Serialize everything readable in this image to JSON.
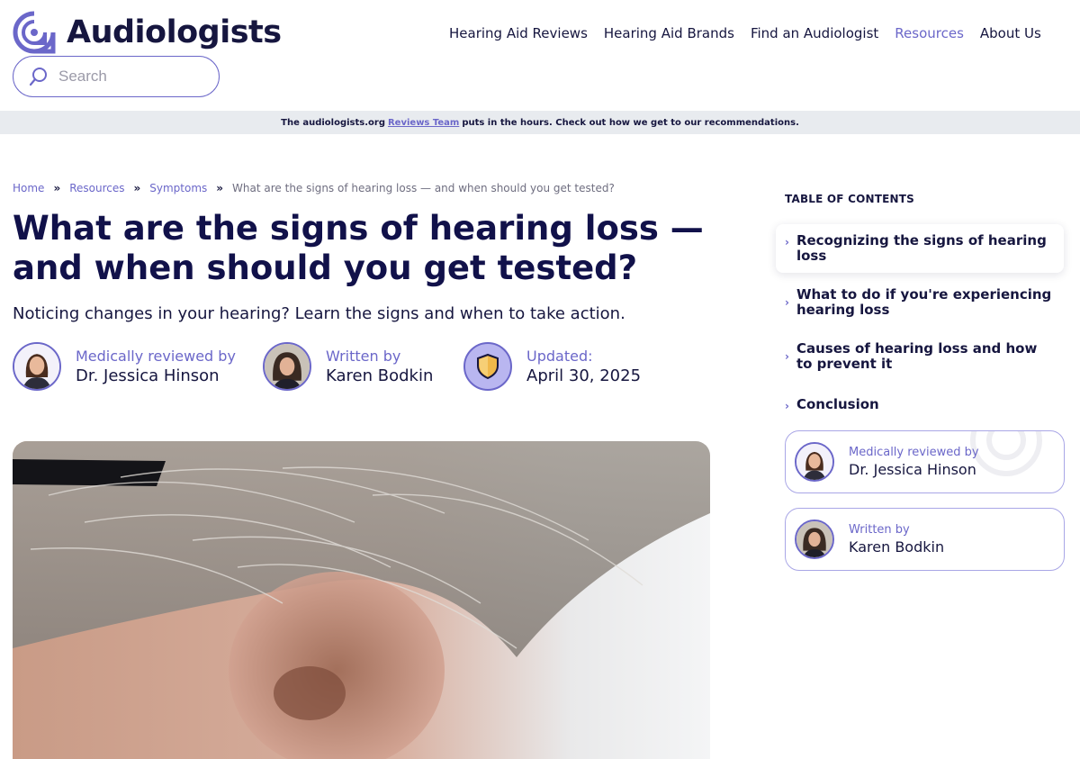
{
  "brand": {
    "name": "Audiologists",
    "accent": "#6b67c9",
    "ink": "#16163f"
  },
  "search": {
    "placeholder": "Search"
  },
  "nav": {
    "items": [
      {
        "label": "Hearing Aid Reviews"
      },
      {
        "label": "Hearing Aid Brands"
      },
      {
        "label": "Find an Audiologist"
      },
      {
        "label": "Resources"
      },
      {
        "label": "About Us"
      }
    ]
  },
  "banner": {
    "prefix": "The audiologists.org",
    "link": "Reviews Team",
    "suffix": "puts in the hours. Check out how we get to our recommendations."
  },
  "breadcrumb": {
    "items": [
      "Home",
      "Resources",
      "Symptoms"
    ],
    "current": "What are the signs of hearing loss — and when should you get tested?"
  },
  "article": {
    "title": "What are the signs of hearing loss — and when should you get tested?",
    "subtitle": "Noticing changes in your hearing? Learn the signs and when to take action."
  },
  "meta": {
    "reviewer": {
      "label": "Medically reviewed by",
      "name": "Dr. Jessica Hinson"
    },
    "writer": {
      "label": "Written by",
      "name": "Karen Bodkin"
    },
    "updated": {
      "label": "Updated:",
      "date": "April 30, 2025"
    }
  },
  "toc": {
    "heading": "TABLE OF CONTENTS",
    "items": [
      {
        "label": "Recognizing the signs of hearing loss"
      },
      {
        "label": "What to do if you're experiencing hearing loss"
      },
      {
        "label": "Causes of hearing loss and how to prevent it"
      },
      {
        "label": "Conclusion"
      }
    ]
  },
  "sidebar_cards": {
    "reviewer": {
      "label": "Medically reviewed by",
      "name": "Dr. Jessica Hinson"
    },
    "writer": {
      "label": "Written by",
      "name": "Karen Bodkin"
    }
  }
}
